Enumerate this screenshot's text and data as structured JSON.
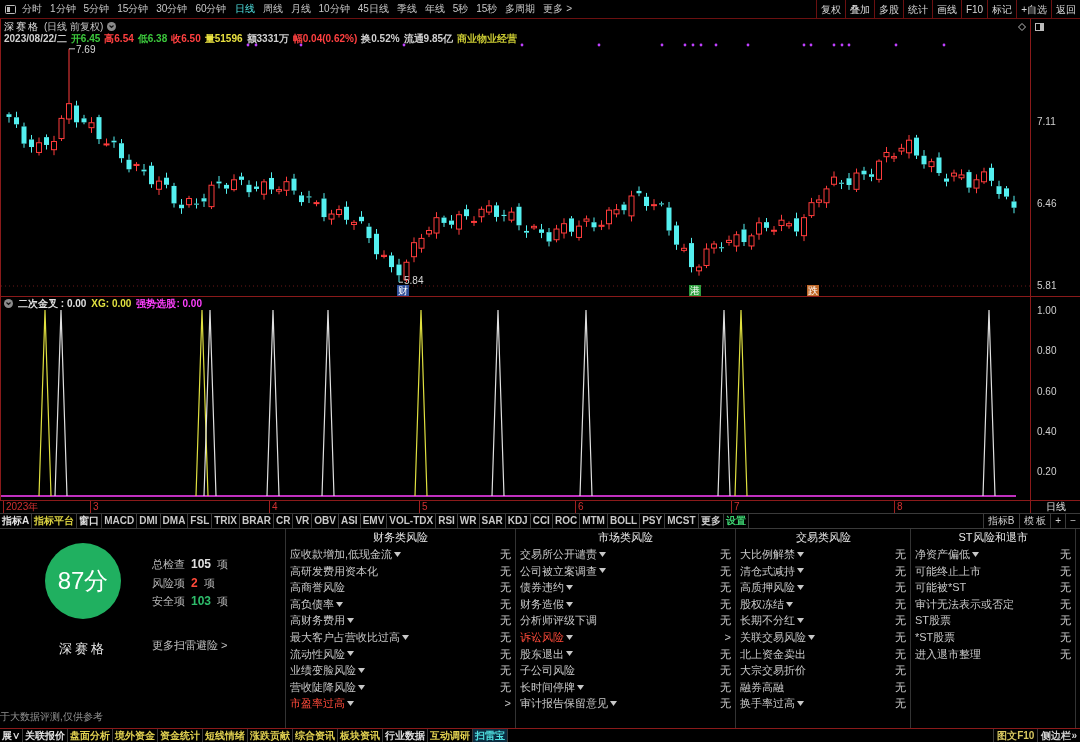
{
  "toolbar": {
    "periods": [
      {
        "label": "分时",
        "selected": false
      },
      {
        "label": "1分钟",
        "selected": false
      },
      {
        "label": "5分钟",
        "selected": false
      },
      {
        "label": "15分钟",
        "selected": false
      },
      {
        "label": "30分钟",
        "selected": false
      },
      {
        "label": "60分钟",
        "selected": false
      },
      {
        "label": "日线",
        "selected": true
      },
      {
        "label": "周线",
        "selected": false
      },
      {
        "label": "月线",
        "selected": false
      },
      {
        "label": "10分钟",
        "selected": false
      },
      {
        "label": "45日线",
        "selected": false
      },
      {
        "label": "季线",
        "selected": false
      },
      {
        "label": "年线",
        "selected": false
      },
      {
        "label": "5秒",
        "selected": false
      },
      {
        "label": "15秒",
        "selected": false
      },
      {
        "label": "多周期",
        "selected": false
      },
      {
        "label": "更多 >",
        "selected": false
      }
    ],
    "actions": [
      "复权",
      "叠加",
      "多股",
      "统计",
      "画线",
      "F10",
      "标记",
      "+自选",
      "返回"
    ]
  },
  "stock_header": {
    "name": "深赛格",
    "mode": "(日线 前复权)"
  },
  "quote": [
    {
      "text": "2023/08/22/二",
      "color": "#d0d0d0"
    },
    {
      "text": "开6.45",
      "color": "#3cc83c"
    },
    {
      "text": "高6.54",
      "color": "#ff4040"
    },
    {
      "text": "低6.38",
      "color": "#3cc83c"
    },
    {
      "text": "收6.50",
      "color": "#ff4040"
    },
    {
      "text": "量51596",
      "color": "#e8e040"
    },
    {
      "text": "额3331万",
      "color": "#d0d0d0"
    },
    {
      "text": "幅0.04(0.62%)",
      "color": "#ff4040"
    },
    {
      "text": "换0.52%",
      "color": "#d0d0d0"
    },
    {
      "text": "流通9.85亿",
      "color": "#d0d0d0"
    },
    {
      "text": "商业物业经营",
      "color": "#c8c832"
    }
  ],
  "price_chart": {
    "high_label": "7.69",
    "low_label": "5.84",
    "axis_labels": [
      "7.11",
      "6.46",
      "5.81"
    ],
    "events": [
      {
        "label": "财",
        "color": "#2f4f9a"
      },
      {
        "label": "港",
        "color": "#2e9e3e"
      },
      {
        "label": "跌",
        "color": "#c06828"
      }
    ]
  },
  "indicator_chart": {
    "legend": [
      {
        "text": "二次金叉 : 0.00",
        "color": "#e0e0e0"
      },
      {
        "text": "XG: 0.00",
        "color": "#e0e040"
      },
      {
        "text": "强势选股: 0.00",
        "color": "#ff40ff"
      }
    ],
    "axis_labels": [
      "1.00",
      "0.80",
      "0.60",
      "0.40",
      "0.20"
    ]
  },
  "date_axis": {
    "labels": [
      "2023年",
      "3",
      "4",
      "5",
      "6",
      "7",
      "8"
    ],
    "period": "日线"
  },
  "indicator_tabs": {
    "left": [
      {
        "label": "指标A",
        "color": "#e0e0e0"
      },
      {
        "label": "指标平台",
        "color": "#d8d040"
      },
      {
        "label": "窗口",
        "color": "#e0e0e0"
      },
      {
        "label": "MACD",
        "color": "#c8c8c8"
      },
      {
        "label": "DMI",
        "color": "#c8c8c8"
      },
      {
        "label": "DMA",
        "color": "#c8c8c8"
      },
      {
        "label": "FSL",
        "color": "#c8c8c8"
      },
      {
        "label": "TRIX",
        "color": "#c8c8c8"
      },
      {
        "label": "BRAR",
        "color": "#c8c8c8"
      },
      {
        "label": "CR",
        "color": "#c8c8c8"
      },
      {
        "label": "VR",
        "color": "#c8c8c8"
      },
      {
        "label": "OBV",
        "color": "#c8c8c8"
      },
      {
        "label": "ASI",
        "color": "#c8c8c8"
      },
      {
        "label": "EMV",
        "color": "#c8c8c8"
      },
      {
        "label": "VOL-TDX",
        "color": "#c8c8c8"
      },
      {
        "label": "RSI",
        "color": "#c8c8c8"
      },
      {
        "label": "WR",
        "color": "#c8c8c8"
      },
      {
        "label": "SAR",
        "color": "#c8c8c8"
      },
      {
        "label": "KDJ",
        "color": "#c8c8c8"
      },
      {
        "label": "CCI",
        "color": "#c8c8c8"
      },
      {
        "label": "ROC",
        "color": "#c8c8c8"
      },
      {
        "label": "MTM",
        "color": "#c8c8c8"
      },
      {
        "label": "BOLL",
        "color": "#c8c8c8"
      },
      {
        "label": "PSY",
        "color": "#c8c8c8"
      },
      {
        "label": "MCST",
        "color": "#c8c8c8"
      },
      {
        "label": "更多",
        "color": "#c8c8c8"
      },
      {
        "label": "设置",
        "color": "#3cd070"
      }
    ],
    "right": [
      "指标B",
      "模 板",
      "+",
      "−"
    ]
  },
  "risk_scan": {
    "score": "87分",
    "name": "深赛格",
    "stats": [
      {
        "label": "总检查",
        "value": "105",
        "unit": "项",
        "color": "#e0e0e0"
      },
      {
        "label": "风险项",
        "value": "2",
        "unit": "项",
        "color": "#ff4a3a"
      },
      {
        "label": "安全项",
        "value": "103",
        "unit": "项",
        "color": "#2ebd6b"
      }
    ],
    "more_link": "更多扫雷避险 >",
    "note": "于大数据评测,仅供参考",
    "categories": [
      {
        "title": "财务类风险",
        "rows": [
          {
            "name": "应收款增加,低现金流",
            "menu": true,
            "alert": false,
            "value": "无"
          },
          {
            "name": "高研发费用资本化",
            "menu": false,
            "alert": false,
            "value": "无"
          },
          {
            "name": "高商誉风险",
            "menu": false,
            "alert": false,
            "value": "无"
          },
          {
            "name": "高负债率",
            "menu": true,
            "alert": false,
            "value": "无"
          },
          {
            "name": "高财务费用",
            "menu": true,
            "alert": false,
            "value": "无"
          },
          {
            "name": "最大客户占营收比过高",
            "menu": true,
            "alert": false,
            "value": "无"
          },
          {
            "name": "流动性风险",
            "menu": true,
            "alert": false,
            "value": "无"
          },
          {
            "name": "业绩变脸风险",
            "menu": true,
            "alert": false,
            "value": "无"
          },
          {
            "name": "营收陡降风险",
            "menu": true,
            "alert": false,
            "value": "无"
          },
          {
            "name": "市盈率过高",
            "menu": true,
            "alert": true,
            "value": ">"
          }
        ]
      },
      {
        "title": "市场类风险",
        "rows": [
          {
            "name": "交易所公开谴责",
            "menu": true,
            "alert": false,
            "value": "无"
          },
          {
            "name": "公司被立案调查",
            "menu": true,
            "alert": false,
            "value": "无"
          },
          {
            "name": "债券违约",
            "menu": true,
            "alert": false,
            "value": "无"
          },
          {
            "name": "财务造假",
            "menu": true,
            "alert": false,
            "value": "无"
          },
          {
            "name": "分析师评级下调",
            "menu": false,
            "alert": false,
            "value": "无"
          },
          {
            "name": "诉讼风险",
            "menu": true,
            "alert": true,
            "value": ">"
          },
          {
            "name": "股东退出",
            "menu": true,
            "alert": false,
            "value": "无"
          },
          {
            "name": "子公司风险",
            "menu": false,
            "alert": false,
            "value": "无"
          },
          {
            "name": "长时间停牌",
            "menu": true,
            "alert": false,
            "value": "无"
          },
          {
            "name": "审计报告保留意见",
            "menu": true,
            "alert": false,
            "value": "无"
          }
        ]
      },
      {
        "title": "交易类风险",
        "rows": [
          {
            "name": "大比例解禁",
            "menu": true,
            "alert": false,
            "value": "无"
          },
          {
            "name": "清仓式减持",
            "menu": true,
            "alert": false,
            "value": "无"
          },
          {
            "name": "高质押风险",
            "menu": true,
            "alert": false,
            "value": "无"
          },
          {
            "name": "股权冻结",
            "menu": true,
            "alert": false,
            "value": "无"
          },
          {
            "name": "长期不分红",
            "menu": true,
            "alert": false,
            "value": "无"
          },
          {
            "name": "关联交易风险",
            "menu": true,
            "alert": false,
            "value": "无"
          },
          {
            "name": "北上资金卖出",
            "menu": false,
            "alert": false,
            "value": "无"
          },
          {
            "name": "大宗交易折价",
            "menu": false,
            "alert": false,
            "value": "无"
          },
          {
            "name": "融券高融",
            "menu": false,
            "alert": false,
            "value": "无"
          },
          {
            "name": "换手率过高",
            "menu": true,
            "alert": false,
            "value": "无"
          }
        ]
      },
      {
        "title": "ST风险和退市",
        "rows": [
          {
            "name": "净资产偏低",
            "menu": true,
            "alert": false,
            "value": "无"
          },
          {
            "name": "可能终止上市",
            "menu": false,
            "alert": false,
            "value": "无"
          },
          {
            "name": "可能被*ST",
            "menu": false,
            "alert": false,
            "value": "无"
          },
          {
            "name": "审计无法表示或否定",
            "menu": false,
            "alert": false,
            "value": "无"
          },
          {
            "name": "ST股票",
            "menu": false,
            "alert": false,
            "value": "无"
          },
          {
            "name": "*ST股票",
            "menu": false,
            "alert": false,
            "value": "无"
          },
          {
            "name": "进入退市整理",
            "menu": false,
            "alert": false,
            "value": "无"
          }
        ]
      }
    ]
  },
  "bottom_tabs": [
    {
      "label": "展∨",
      "color": "#e0e0e0",
      "selected": false
    },
    {
      "label": "关联报价",
      "color": "#e0e0e0",
      "selected": false
    },
    {
      "label": "盘面分析",
      "color": "#e0d050",
      "selected": false
    },
    {
      "label": "境外资金",
      "color": "#e0d050",
      "selected": false
    },
    {
      "label": "资金统计",
      "color": "#e0d050",
      "selected": false
    },
    {
      "label": "短线情绪",
      "color": "#e0d050",
      "selected": false
    },
    {
      "label": "涨跌贡献",
      "color": "#e0d050",
      "selected": false
    },
    {
      "label": "综合资讯",
      "color": "#e0d050",
      "selected": false
    },
    {
      "label": "板块资讯",
      "color": "#e0d050",
      "selected": false
    },
    {
      "label": "行业数据",
      "color": "#e0e0e0",
      "selected": false
    },
    {
      "label": "互动调研",
      "color": "#e0d050",
      "selected": false
    },
    {
      "label": "扫雷宝",
      "selected": true
    }
  ],
  "bottom_right": [
    {
      "label": "图文F10",
      "color": "#d8c860"
    },
    {
      "label": "侧边栏»",
      "color": "#d0d0d0"
    }
  ]
}
